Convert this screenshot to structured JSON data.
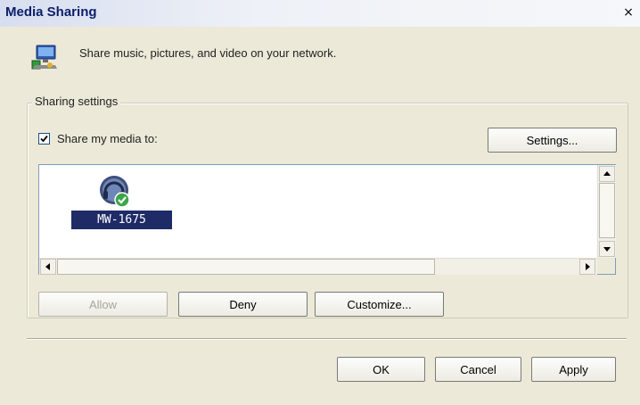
{
  "window": {
    "title": "Media Sharing",
    "close_glyph": "×"
  },
  "header": {
    "icon": "media-sharing-icon",
    "text": "Share music, pictures, and video on your network."
  },
  "sharing_settings": {
    "legend": "Sharing settings",
    "share_checkbox": {
      "label": "Share my media to:",
      "checked": true
    },
    "settings_button": "Settings...",
    "devices": [
      {
        "name": "MW-1675",
        "icon": "media-device-allowed-icon",
        "selected": true
      }
    ],
    "actions": {
      "allow": "Allow",
      "deny": "Deny",
      "customize": "Customize..."
    }
  },
  "footer": {
    "ok": "OK",
    "cancel": "Cancel",
    "apply": "Apply"
  },
  "colors": {
    "selection_bg": "#1f2b67",
    "title_text": "#0b1f6b",
    "dialog_bg": "#ece9d8"
  }
}
